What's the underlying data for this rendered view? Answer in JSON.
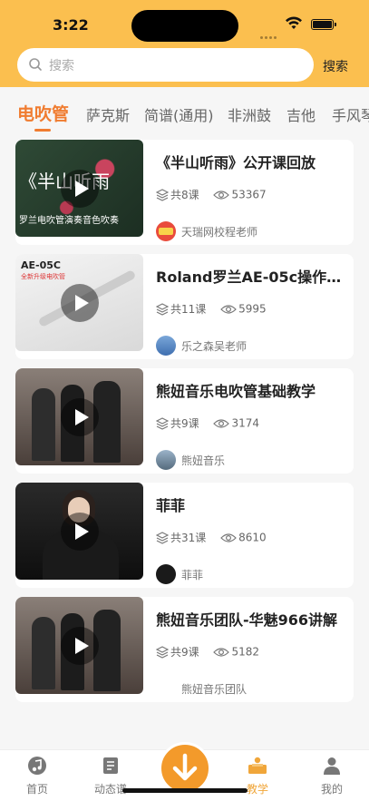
{
  "status": {
    "time": "3:22"
  },
  "search": {
    "placeholder": "搜索",
    "button": "搜索"
  },
  "tabs": [
    "电吹管",
    "萨克斯",
    "简谱(通用)",
    "非洲鼓",
    "吉他",
    "手风琴"
  ],
  "courses": [
    {
      "title": "《半山听雨》公开课回放",
      "lessons": "共8课",
      "views": "53367",
      "author": "天瑞网校程老师",
      "thumb_text": "《半山听雨",
      "thumb_sub": "罗兰电吹管演奏音色吹奏"
    },
    {
      "title": "Roland罗兰AE-05c操作…",
      "lessons": "共11课",
      "views": "5995",
      "author": "乐之森吴老师",
      "thumb_text": "AE-05C",
      "thumb_sub": "全新升级电吹管"
    },
    {
      "title": "熊妞音乐电吹管基础教学",
      "lessons": "共9课",
      "views": "3174",
      "author": "熊妞音乐",
      "thumb_text": "",
      "thumb_sub": ""
    },
    {
      "title": "菲菲",
      "lessons": "共31课",
      "views": "8610",
      "author": "菲菲",
      "thumb_text": "",
      "thumb_sub": ""
    },
    {
      "title": "熊妞音乐团队-华魅966讲解",
      "lessons": "共9课",
      "views": "5182",
      "author": "熊妞音乐团队",
      "thumb_text": "",
      "thumb_sub": ""
    }
  ],
  "nav": [
    {
      "label": "首页",
      "icon": "music-note-icon"
    },
    {
      "label": "动态谱",
      "icon": "score-book-icon"
    },
    {
      "label": "",
      "icon": "download-arrow-icon"
    },
    {
      "label": "教学",
      "icon": "teacher-desk-icon"
    },
    {
      "label": "我的",
      "icon": "person-icon"
    }
  ],
  "colors": {
    "header": "#fbbf4f",
    "accent": "#f07c30",
    "nav_active": "#f0a63a",
    "center_button": "#f39a2b"
  }
}
